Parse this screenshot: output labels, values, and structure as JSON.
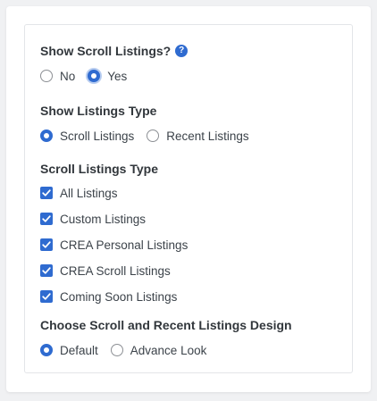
{
  "show_scroll_listings": {
    "title": "Show Scroll Listings?",
    "help_icon": "?",
    "options": [
      {
        "label": "No",
        "checked": false
      },
      {
        "label": "Yes",
        "checked": true
      }
    ]
  },
  "show_listings_type": {
    "title": "Show Listings Type",
    "options": [
      {
        "label": "Scroll Listings",
        "checked": true
      },
      {
        "label": "Recent Listings",
        "checked": false
      }
    ]
  },
  "scroll_listings_type": {
    "title": "Scroll Listings Type",
    "options": [
      {
        "label": "All Listings",
        "checked": true
      },
      {
        "label": "Custom Listings",
        "checked": true
      },
      {
        "label": "CREA Personal Listings",
        "checked": true
      },
      {
        "label": "CREA Scroll Listings",
        "checked": true
      },
      {
        "label": "Coming Soon Listings",
        "checked": true
      }
    ]
  },
  "listings_design": {
    "title": "Choose Scroll and Recent Listings Design",
    "options": [
      {
        "label": "Default",
        "checked": true
      },
      {
        "label": "Advance Look",
        "checked": false
      }
    ]
  },
  "colors": {
    "accent": "#2f6bd0",
    "text": "#3c434a",
    "heading": "#32373c"
  }
}
